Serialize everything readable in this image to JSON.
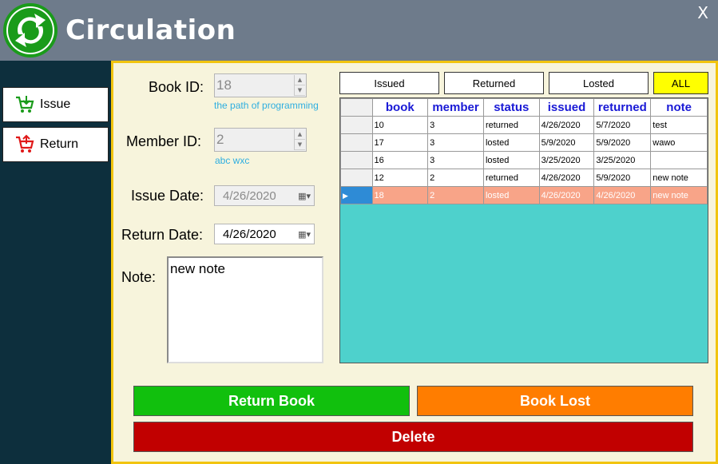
{
  "window": {
    "title": "Circulation",
    "close_label": "X"
  },
  "sidebar": {
    "items": [
      {
        "label": "Issue",
        "icon": "cart-add-icon",
        "color": "#1a9b1a"
      },
      {
        "label": "Return",
        "icon": "cart-return-icon",
        "color": "#e01818"
      }
    ]
  },
  "form": {
    "book_id": {
      "label": "Book ID:",
      "value": "18",
      "hint": "the path of programming"
    },
    "member_id": {
      "label": "Member ID:",
      "value": "2",
      "hint": "abc wxc"
    },
    "issue_date": {
      "label": "Issue Date:",
      "value": "4/26/2020"
    },
    "return_date": {
      "label": "Return Date:",
      "value": "4/26/2020"
    },
    "note": {
      "label": "Note:",
      "value": "new note"
    }
  },
  "filters": [
    "Issued",
    "Returned",
    "Losted",
    "ALL"
  ],
  "grid": {
    "columns": [
      "book",
      "member",
      "status",
      "issued",
      "returned",
      "note"
    ],
    "rows": [
      [
        "10",
        "3",
        "returned",
        "4/26/2020",
        "5/7/2020",
        "test"
      ],
      [
        "17",
        "3",
        "losted",
        "5/9/2020",
        "5/9/2020",
        "wawo"
      ],
      [
        "16",
        "3",
        "losted",
        "3/25/2020",
        "3/25/2020",
        ""
      ],
      [
        "12",
        "2",
        "returned",
        "4/26/2020",
        "5/9/2020",
        "new note"
      ],
      [
        "18",
        "2",
        "losted",
        "4/26/2020",
        "4/26/2020",
        "new note"
      ]
    ],
    "selected_row": 4
  },
  "actions": {
    "return_book": "Return Book",
    "book_lost": "Book Lost",
    "delete": "Delete"
  },
  "colors": {
    "header_bg": "#6e7b8b",
    "sidebar_bg": "#0d2f3d",
    "main_bg": "#f7f4dc",
    "main_border": "#f1c40f",
    "grid_bg": "#4ed1cc",
    "selected_row": "#f8a488",
    "return_book": "#11c00d",
    "book_lost": "#ff7d00",
    "delete": "#c10000",
    "all_filter": "#ffff00"
  }
}
